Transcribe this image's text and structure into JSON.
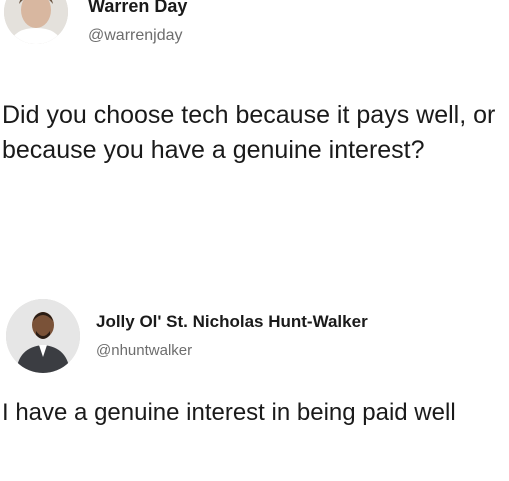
{
  "tweets": [
    {
      "author_name": "Warren Day",
      "handle": "@warrenjday",
      "text": "Did you choose tech because it pays well, or because you have a genuine interest?"
    },
    {
      "author_name": "Jolly Ol' St. Nicholas Hunt-Walker",
      "handle": "@nhuntwalker",
      "text": "I have a genuine interest in being paid well"
    }
  ]
}
